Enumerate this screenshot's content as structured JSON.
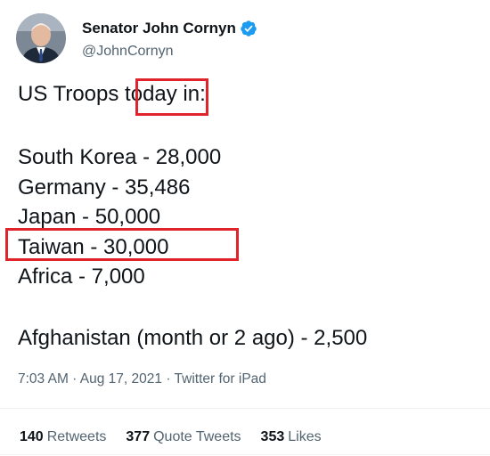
{
  "user": {
    "display_name": "Senator John Cornyn",
    "handle": "@JohnCornyn",
    "verified_icon": "verified-badge-icon",
    "verified_color": "#1d9bf0"
  },
  "tweet": {
    "line1_before": "US Troops ",
    "line1_highlight": "today",
    "line1_after": " in:",
    "countries": [
      "South Korea - 28,000",
      "Germany - 35,486",
      "Japan - 50,000",
      "Taiwan - 30,000",
      "Africa - 7,000"
    ],
    "last_line": "Afghanistan (month or 2 ago) - 2,500"
  },
  "meta": {
    "time": "7:03 AM",
    "sep1": " · ",
    "date": "Aug 17, 2021",
    "sep2": " · ",
    "source": "Twitter for iPad"
  },
  "stats": {
    "retweets_count": "140",
    "retweets_label": "Retweets",
    "quotes_count": "377",
    "quotes_label": "Quote Tweets",
    "likes_count": "353",
    "likes_label": "Likes"
  },
  "highlight_color": "#e0242b"
}
